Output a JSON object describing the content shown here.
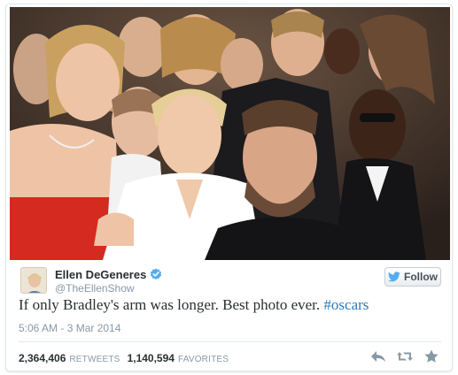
{
  "user": {
    "display_name": "Ellen DeGeneres",
    "handle": "@TheEllenShow",
    "verified": true,
    "avatar_icon": "ellen-avatar"
  },
  "follow_button": {
    "label": "Follow",
    "icon": "twitter-bird-icon"
  },
  "tweet": {
    "text": "If only Bradley's arm was longer. Best photo ever.",
    "hashtag": "#oscars",
    "timestamp": "5:06 AM - 3 Mar 2014"
  },
  "stats": {
    "retweets_count": "2,364,406",
    "retweets_label": "RETWEETS",
    "favorites_count": "1,140,594",
    "favorites_label": "FAVORITES"
  },
  "actions": [
    "reply-icon",
    "retweet-icon",
    "favorite-icon"
  ],
  "colors": {
    "link": "#2b7bb9",
    "verified": "#55acee",
    "muted": "#8899a6",
    "action_icon": "#8899a6"
  }
}
